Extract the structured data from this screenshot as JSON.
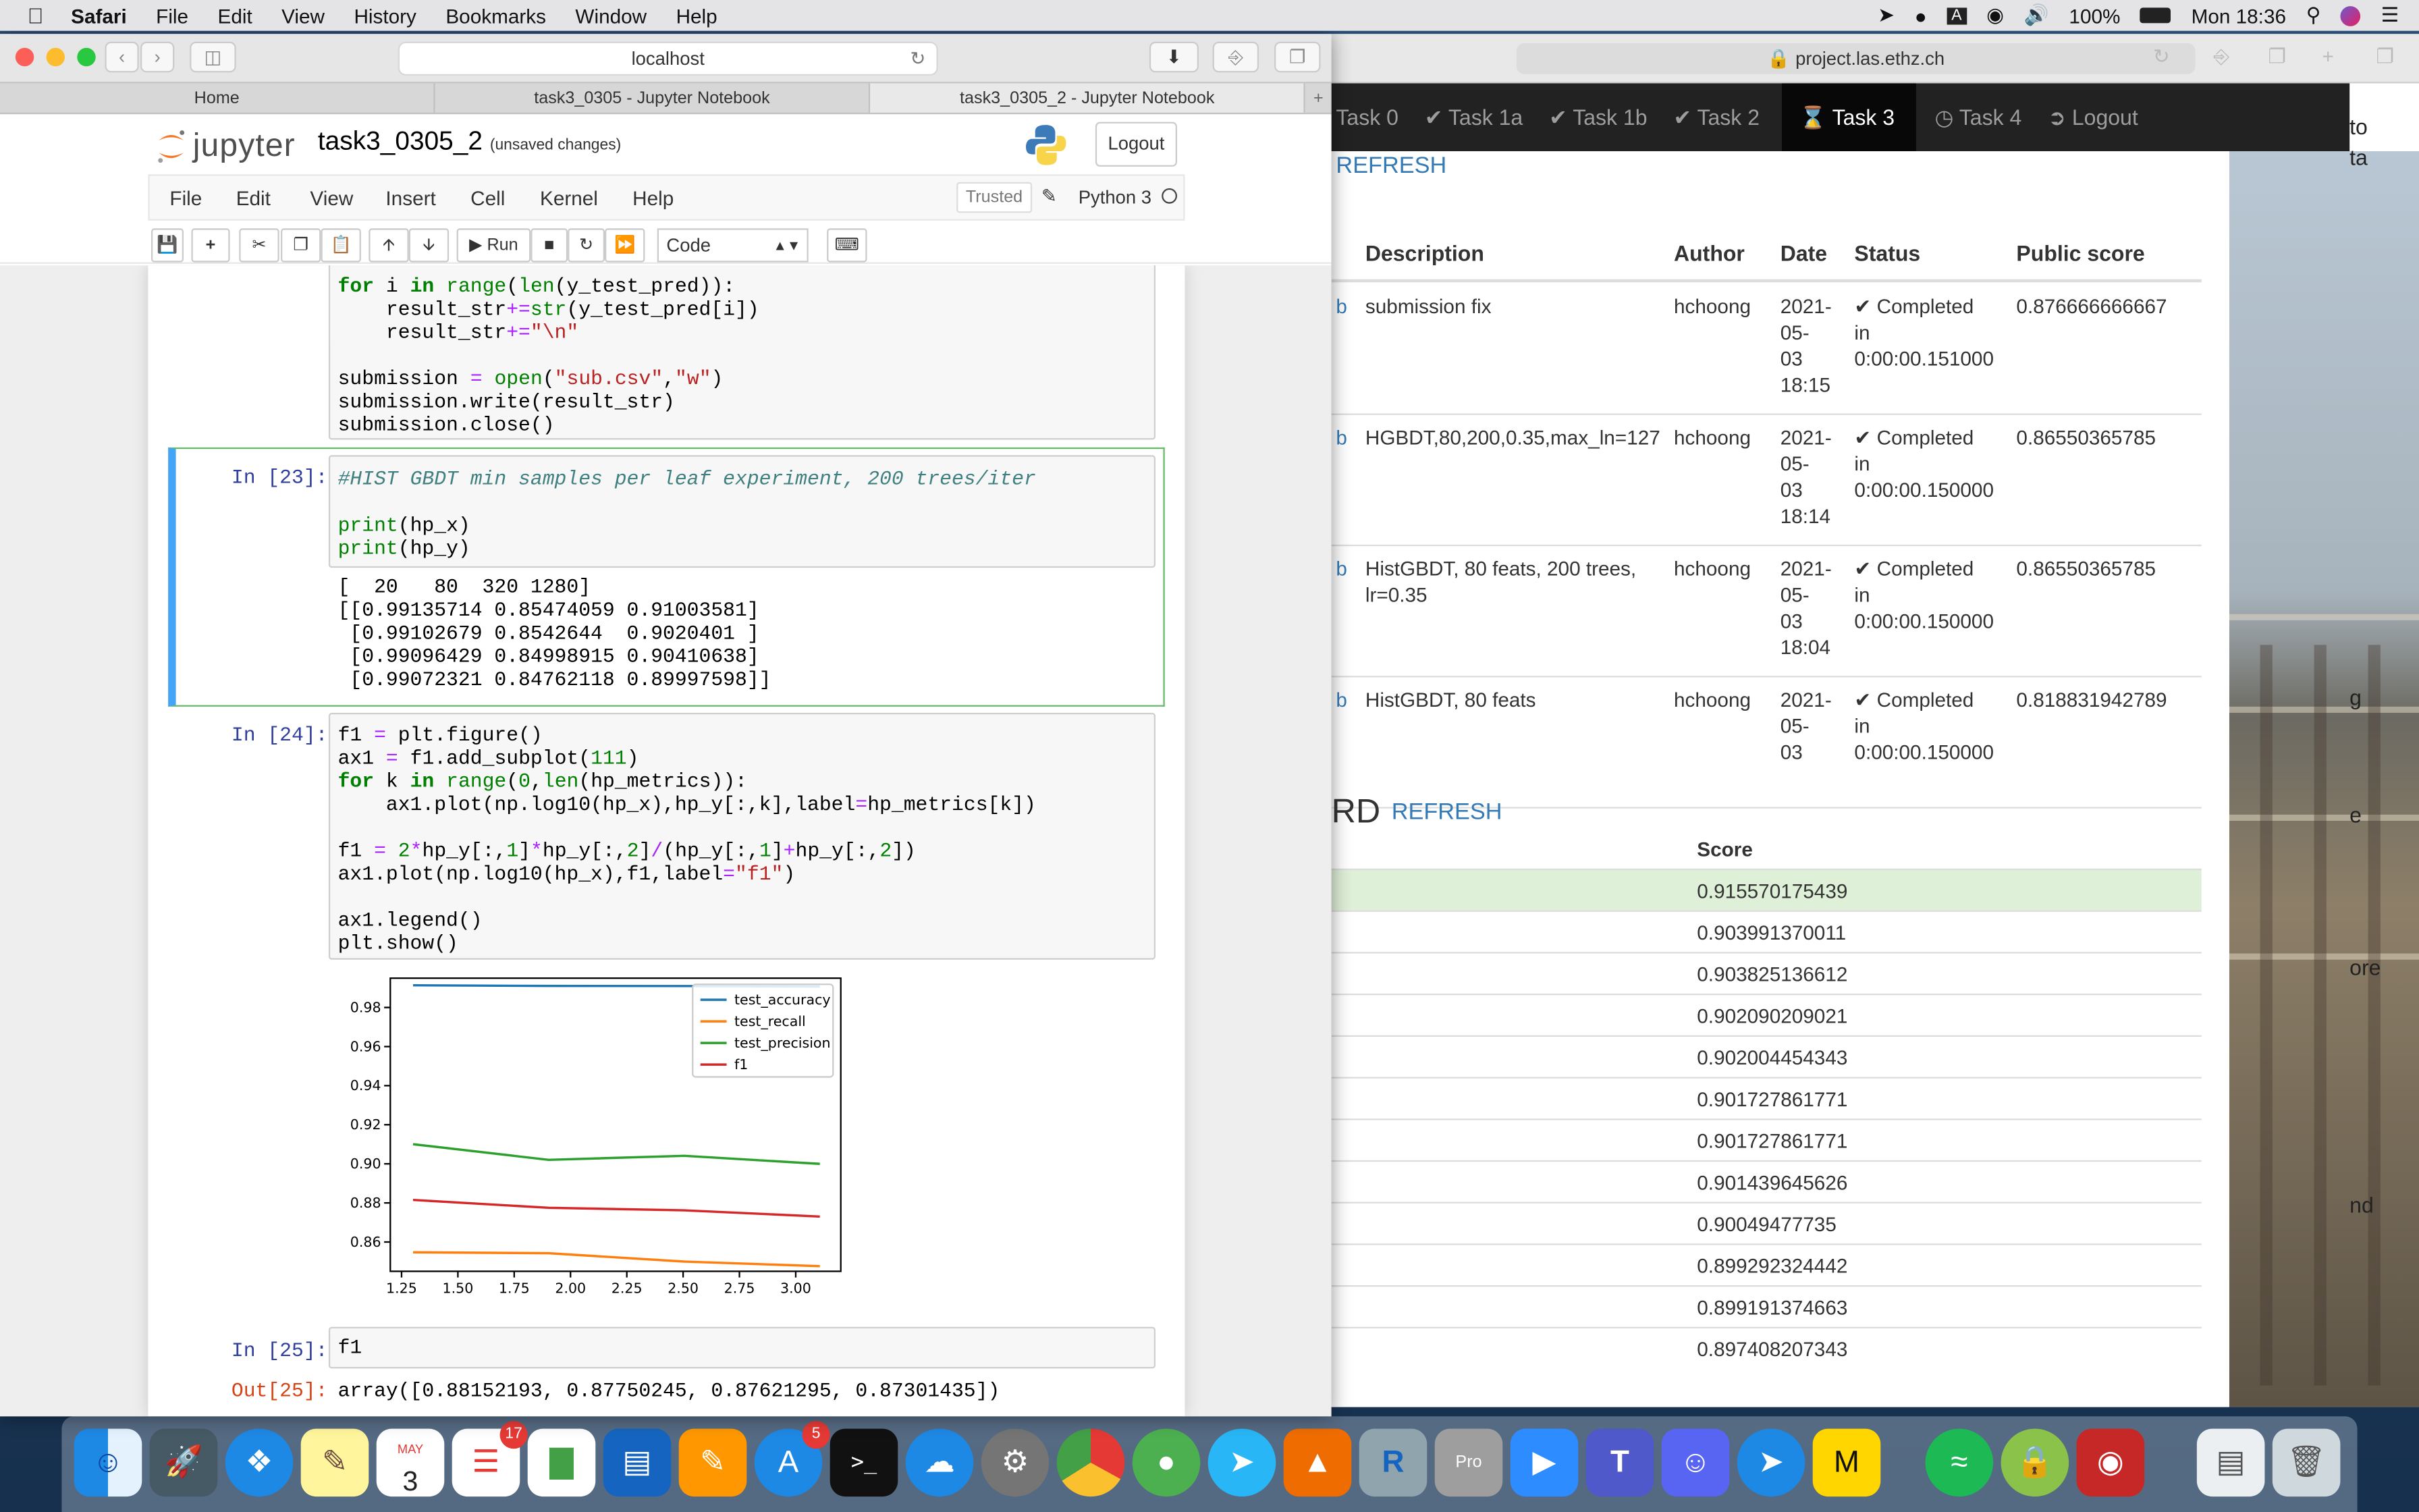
{
  "menubar": {
    "app": "Safari",
    "items": [
      "File",
      "Edit",
      "View",
      "History",
      "Bookmarks",
      "Window",
      "Help"
    ],
    "battery": "100%",
    "clock": "Mon 18:36"
  },
  "safari": {
    "url": "localhost",
    "tabs": [
      "Home",
      "task3_0305 - Jupyter Notebook",
      "task3_0305_2 - Jupyter Notebook"
    ]
  },
  "jupyter": {
    "logo_text": "jupyter",
    "notebook_name": "task3_0305_2",
    "save_status": "(unsaved changes)",
    "logout": "Logout",
    "menu": [
      "File",
      "Edit",
      "View",
      "Insert",
      "Cell",
      "Kernel",
      "Help"
    ],
    "trusted": "Trusted",
    "kernel": "Python 3",
    "run_label": "Run",
    "cell_type": "Code"
  },
  "cells": {
    "c22_code": "for i in range(len(y_test_pred)):\n    result_str+=str(y_test_pred[i])\n    result_str+=\"\\n\"\n\nsubmission = open(\"sub.csv\",\"w\")\nsubmission.write(result_str)\nsubmission.close()",
    "c23_prompt": "In [23]:",
    "c23_comment": "#HIST GBDT min samples per leaf experiment, 200 trees/iter",
    "c23_code": "print(hp_x)\nprint(hp_y)",
    "c23_output": "[  20   80  320 1280]\n[[0.99135714 0.85474059 0.91003581]\n [0.99102679 0.8542644  0.9020401 ]\n [0.99096429 0.84998915 0.90410638]\n [0.99072321 0.84762118 0.89997598]]",
    "c24_prompt": "In [24]:",
    "c24_code": "f1 = plt.figure()\nax1 = f1.add_subplot(111)\nfor k in range(0,len(hp_metrics)):\n    ax1.plot(np.log10(hp_x),hp_y[:,k],label=hp_metrics[k])\n\nf1 = 2*hp_y[:,1]*hp_y[:,2]/(hp_y[:,1]+hp_y[:,2])\nax1.plot(np.log10(hp_x),f1,label=\"f1\")\n\nax1.legend()\nplt.show()",
    "c25_prompt": "In [25]:",
    "c25_code": "f1",
    "c25_out_prompt": "Out[25]:",
    "c25_output": "array([0.88152193, 0.87750245, 0.87621295, 0.87301435])"
  },
  "chart_data": {
    "type": "line",
    "title": "",
    "xlabel": "",
    "ylabel": "",
    "x": [
      1.301,
      1.903,
      2.505,
      3.107
    ],
    "xlim": [
      1.2,
      3.2
    ],
    "ylim": [
      0.845,
      0.995
    ],
    "xticks": [
      "1.25",
      "1.50",
      "1.75",
      "2.00",
      "2.25",
      "2.50",
      "2.75",
      "3.00"
    ],
    "yticks": [
      "0.86",
      "0.88",
      "0.90",
      "0.92",
      "0.94",
      "0.96",
      "0.98"
    ],
    "legend_position": "upper right",
    "series": [
      {
        "name": "test_accuracy",
        "color": "#1f77b4",
        "values": [
          0.99135714,
          0.99102679,
          0.99096429,
          0.99072321
        ]
      },
      {
        "name": "test_recall",
        "color": "#ff7f0e",
        "values": [
          0.85474059,
          0.8542644,
          0.84998915,
          0.84762118
        ]
      },
      {
        "name": "test_precision",
        "color": "#2ca02c",
        "values": [
          0.91003581,
          0.9020401,
          0.90410638,
          0.89997598
        ]
      },
      {
        "name": "f1",
        "color": "#d62728",
        "values": [
          0.88152193,
          0.87750245,
          0.87621295,
          0.87301435
        ]
      }
    ]
  },
  "project": {
    "url": "project.las.ethz.ch",
    "nav": [
      "Task 0",
      "Task 1a",
      "Task 1b",
      "Task 2",
      "Task 3",
      "Task 4",
      "Logout"
    ],
    "refresh": "REFRESH",
    "columns": [
      "Description",
      "Author",
      "Date",
      "Status",
      "Public score"
    ],
    "submissions": [
      {
        "link": "b",
        "desc": "submission fix",
        "author": "hchoong",
        "date": [
          "2021-",
          "05-",
          "03",
          "18:15"
        ],
        "status": [
          "Completed",
          "in",
          "0:00:00.151000"
        ],
        "score": "0.876666666667"
      },
      {
        "link": "b",
        "desc": "HGBDT,80,200,0.35,max_ln=127",
        "author": "hchoong",
        "date": [
          "2021-",
          "05-",
          "03",
          "18:14"
        ],
        "status": [
          "Completed",
          "in",
          "0:00:00.150000"
        ],
        "score": "0.86550365785"
      },
      {
        "link": "b",
        "desc": "HistGBDT, 80 feats, 200 trees, lr=0.35",
        "author": "hchoong",
        "date": [
          "2021-",
          "05-",
          "03",
          "18:04"
        ],
        "status": [
          "Completed",
          "in",
          "0:00:00.150000"
        ],
        "score": "0.86550365785"
      },
      {
        "link": "b",
        "desc": "HistGBDT, 80 feats",
        "author": "hchoong",
        "date": [
          "2021-",
          "05-",
          "03"
        ],
        "status": [
          "Completed",
          "in",
          "0:00:00.150000"
        ],
        "score": "0.818831942789"
      }
    ],
    "leaderboard_title": "RD",
    "leaderboard_refresh": "REFRESH",
    "score_header": "Score",
    "scores": [
      "0.915570175439",
      "0.903991370011",
      "0.903825136612",
      "0.902090209021",
      "0.902004454343",
      "0.901727861771",
      "0.901727861771",
      "0.901439645626",
      "0.90049477735",
      "0.899292324442",
      "0.899191374663",
      "0.897408207343"
    ],
    "edge_words": [
      "to",
      "ta",
      "g",
      "e",
      "ore",
      "nd"
    ]
  },
  "dock": {
    "calendar_month": "MAY",
    "calendar_day": "3",
    "reminders_badge": "17",
    "appstore_badge": "5"
  }
}
